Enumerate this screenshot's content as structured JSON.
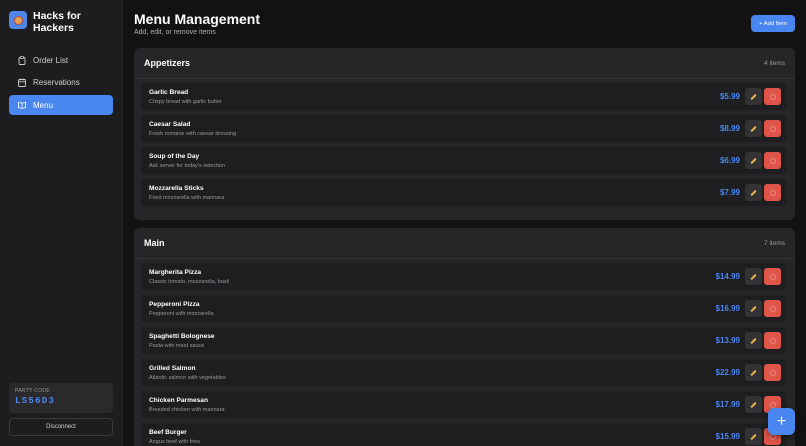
{
  "app": {
    "title": "Hacks for Hackers"
  },
  "sidebar": {
    "items": [
      {
        "label": "Order List",
        "icon": "clipboard-icon"
      },
      {
        "label": "Reservations",
        "icon": "calendar-icon"
      },
      {
        "label": "Menu",
        "icon": "book-icon",
        "active": true
      }
    ],
    "party_label": "PARTY CODE",
    "party_code": "LS56D3",
    "disconnect_label": "Disconnect"
  },
  "header": {
    "title": "Menu Management",
    "subtitle": "Add, edit, or remove items",
    "add_label": "+ Add Item"
  },
  "sections": [
    {
      "name": "Appetizers",
      "count": "4 items",
      "items": [
        {
          "name": "Garlic Bread",
          "desc": "Crispy bread with garlic butter",
          "price": "$5.99"
        },
        {
          "name": "Caesar Salad",
          "desc": "Fresh romaine with caesar dressing",
          "price": "$8.99"
        },
        {
          "name": "Soup of the Day",
          "desc": "Ask server for today's selection",
          "price": "$6.99"
        },
        {
          "name": "Mozzarella Sticks",
          "desc": "Fried mozzarella with marinara",
          "price": "$7.99"
        }
      ]
    },
    {
      "name": "Main",
      "count": "7 items",
      "items": [
        {
          "name": "Margherita Pizza",
          "desc": "Classic tomato, mozzarella, basil",
          "price": "$14.99"
        },
        {
          "name": "Pepperoni Pizza",
          "desc": "Pepperoni with mozzarella",
          "price": "$16.99"
        },
        {
          "name": "Spaghetti Bolognese",
          "desc": "Pasta with meat sauce",
          "price": "$13.99"
        },
        {
          "name": "Grilled Salmon",
          "desc": "Atlantic salmon with vegetables",
          "price": "$22.99"
        },
        {
          "name": "Chicken Parmesan",
          "desc": "Breaded chicken with marinara",
          "price": "$17.99"
        },
        {
          "name": "Beef Burger",
          "desc": "Angus beef with fries",
          "price": "$15.99"
        }
      ]
    }
  ],
  "fab_label": "+",
  "colors": {
    "accent": "#4a86f0",
    "danger": "#e0554a",
    "background": "#121212"
  }
}
